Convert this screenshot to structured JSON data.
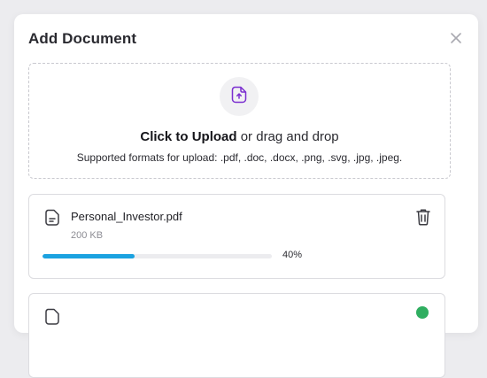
{
  "modal": {
    "title": "Add Document",
    "close_icon": "close-icon"
  },
  "dropzone": {
    "icon": "upload-file-icon",
    "click_label": "Click to Upload",
    "drag_label": "or drag and drop",
    "formats": "Supported formats for upload: .pdf, .doc, .docx, .png, .svg, .jpg, .jpeg."
  },
  "files": [
    {
      "name": "Personal_Investor.pdf",
      "size": "200 KB",
      "progress_text": "40%",
      "progress": 0.4,
      "icon": "document-icon",
      "action_icon": "trash-icon"
    },
    {
      "icon": "document-icon",
      "status_icon": "check-circle-icon"
    }
  ],
  "colors": {
    "accent": "#7b2fd0",
    "progress": "#1ba2e0",
    "success": "#2fae60"
  }
}
